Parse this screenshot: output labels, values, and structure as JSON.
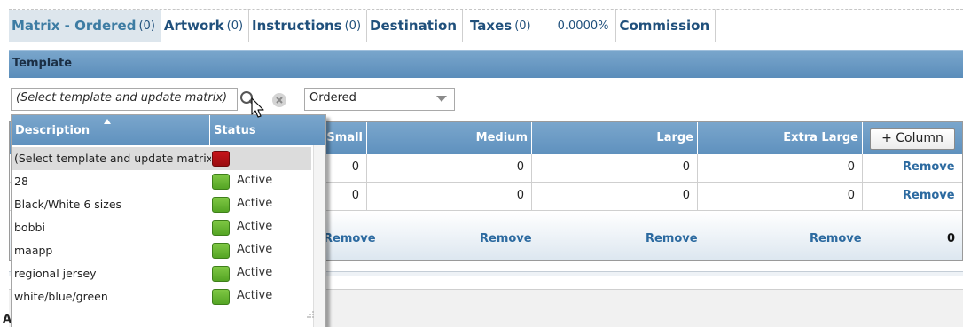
{
  "tabs": [
    {
      "name": "Matrix - Ordered",
      "count": "(0)",
      "active": true
    },
    {
      "name": "Artwork",
      "count": "(0)"
    },
    {
      "name": "Instructions",
      "count": "(0)"
    },
    {
      "name": "Destination",
      "count": ""
    },
    {
      "name": "Taxes",
      "count": "(0)",
      "percent": "0.0000%"
    },
    {
      "name": "Commission",
      "count": ""
    }
  ],
  "template": {
    "header": "Template",
    "input_value": "(Select template and update matrix)",
    "mode_value": "Ordered"
  },
  "matrix": {
    "columns": [
      "Small",
      "Medium",
      "Large",
      "Extra Large"
    ],
    "add_column_label": "+ Column",
    "rows": [
      {
        "values": [
          "0",
          "0",
          "0",
          "0"
        ],
        "action": "Remove"
      },
      {
        "values": [
          "0",
          "0",
          "0",
          "0"
        ],
        "action": "Remove"
      }
    ],
    "footer": {
      "actions": [
        "Remove",
        "Remove",
        "Remove",
        "Remove"
      ],
      "total": "0"
    }
  },
  "lower_band": {
    "letter": "A"
  },
  "popup": {
    "columns": {
      "description": "Description",
      "status": "Status"
    },
    "rows": [
      {
        "description": "(Select template and update matrix)",
        "status": "",
        "color": "#b5121b",
        "selected": true
      },
      {
        "description": "28",
        "status": "Active",
        "color": "#6cb833"
      },
      {
        "description": "Black/White 6 sizes",
        "status": "Active",
        "color": "#6cb833"
      },
      {
        "description": "bobbi",
        "status": "Active",
        "color": "#6cb833"
      },
      {
        "description": "maapp",
        "status": "Active",
        "color": "#6cb833"
      },
      {
        "description": "regional jersey",
        "status": "Active",
        "color": "#6cb833"
      },
      {
        "description": "white/blue/green",
        "status": "Active",
        "color": "#6cb833"
      }
    ]
  },
  "colors": {
    "accent": "#20507c",
    "header_blue": "#6a9bc6",
    "link": "#2c6aa0"
  },
  "icons": [
    "search-icon",
    "clear-icon",
    "chevron-down-icon",
    "mouse-cursor-icon",
    "sort-up-icon",
    "resize-grip-icon"
  ]
}
